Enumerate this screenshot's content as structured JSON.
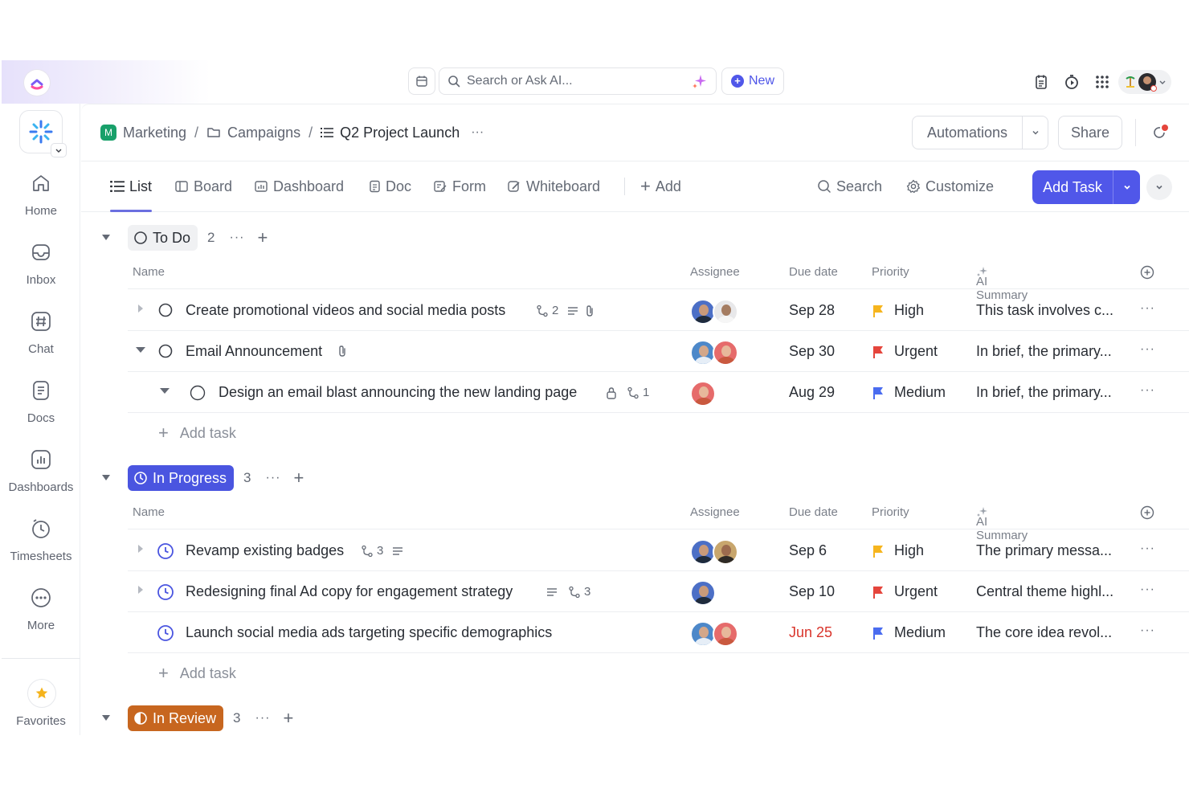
{
  "topbar": {
    "search_placeholder": "Search or Ask AI...",
    "new_label": "New"
  },
  "nav": {
    "items": [
      {
        "label": "Home",
        "icon": "home-icon"
      },
      {
        "label": "Inbox",
        "icon": "inbox-icon"
      },
      {
        "label": "Chat",
        "icon": "hash-icon"
      },
      {
        "label": "Docs",
        "icon": "doc-icon"
      },
      {
        "label": "Dashboards",
        "icon": "dashboard-icon"
      },
      {
        "label": "Timesheets",
        "icon": "clock-icon"
      },
      {
        "label": "More",
        "icon": "more-icon"
      }
    ],
    "favorites_label": "Favorites"
  },
  "breadcrumb": {
    "space_badge": "M",
    "space": "Marketing",
    "folder": "Campaigns",
    "list": "Q2 Project Launch",
    "sep": "/",
    "more": "···"
  },
  "header": {
    "automations_label": "Automations",
    "share_label": "Share"
  },
  "views": {
    "tabs": [
      "List",
      "Board",
      "Dashboard",
      "Doc",
      "Form",
      "Whiteboard"
    ],
    "add_label": "Add",
    "search_label": "Search",
    "customize_label": "Customize",
    "add_task_label": "Add Task"
  },
  "columns": {
    "name": "Name",
    "assignee": "Assignee",
    "due": "Due date",
    "priority": "Priority",
    "ai_summary": "AI Summary"
  },
  "colors": {
    "accent": "#5057e9",
    "in_progress": "#4a55e0",
    "in_review": "#c7661f",
    "high": "#f6b51e",
    "urgent": "#e5453c",
    "medium": "#4a6cf0",
    "overdue": "#d9342b"
  },
  "groups": [
    {
      "status": "To Do",
      "count": "2",
      "more": "···",
      "add_task_label": "Add task",
      "tasks": [
        {
          "name": "Create promotional videos and social media posts",
          "subtasks": "2",
          "due": "Sep 28",
          "priority": "High",
          "summary": "This task involves c..."
        },
        {
          "name": "Email Announcement",
          "due": "Sep 30",
          "priority": "Urgent",
          "summary": "In brief, the primary..."
        },
        {
          "name": "Design an email blast announcing the new landing page",
          "subtasks": "1",
          "due": "Aug 29",
          "priority": "Medium",
          "summary": "In brief, the primary..."
        }
      ]
    },
    {
      "status": "In Progress",
      "count": "3",
      "more": "···",
      "add_task_label": "Add task",
      "tasks": [
        {
          "name": "Revamp existing badges",
          "subtasks": "3",
          "due": "Sep 6",
          "priority": "High",
          "summary": "The primary messa..."
        },
        {
          "name": "Redesigning final Ad copy for engagement strategy",
          "subtasks": "3",
          "due": "Sep 10",
          "priority": "Urgent",
          "summary": "Central theme highl..."
        },
        {
          "name": "Launch social media ads targeting specific demographics",
          "due": "Jun 25",
          "priority": "Medium",
          "summary": "The core idea revol..."
        }
      ]
    },
    {
      "status": "In Review",
      "count": "3",
      "more": "···"
    }
  ]
}
